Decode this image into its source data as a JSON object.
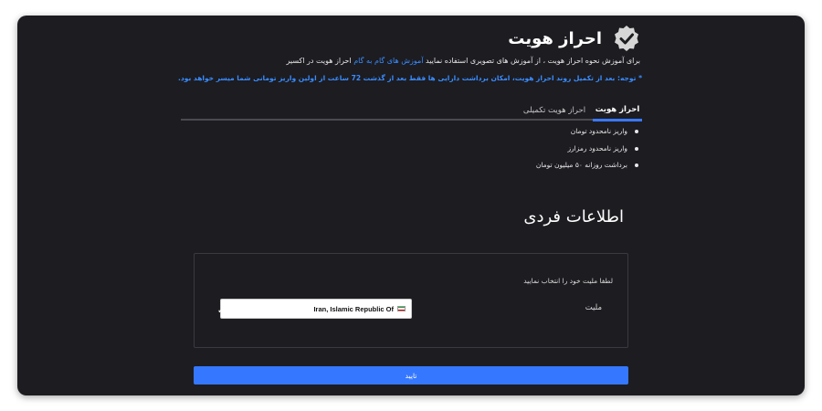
{
  "header": {
    "title": "احراز هویت",
    "intro_before": "برای آموزش نحوه احراز هویت ، از آموزش های تصویری استفاده نمایید",
    "intro_link": "آموزش های گام به گام",
    "intro_after": "احراز هویت در اکسیر",
    "notice": "* توجه: بعد از تکمیل روند احراز هویت، امکان برداشت دارایی ها فقط بعد از گذشت 72 ساعت از اولین واریز تومانی شما میسر خواهد بود."
  },
  "tabs": [
    {
      "label": "احراز هویت",
      "active": true
    },
    {
      "label": "احراز هویت تکمیلی",
      "active": false
    }
  ],
  "benefits": [
    "واریز نامحدود تومان",
    "واریز نامحدود رمزارز",
    "برداشت روزانه ۵۰ میلیون تومان"
  ],
  "section": {
    "title": "اطلاعات فردی"
  },
  "form": {
    "hint": "لطفا ملیت خود را انتخاب نمایید",
    "nationality_label": "ملیت",
    "nationality_value": "Iran, Islamic Republic Of",
    "submit_label": "تایید"
  },
  "colors": {
    "accent": "#3578ff",
    "link": "#3a8dff",
    "background": "#1c1c21"
  },
  "icons": {
    "badge": "verified-badge-icon",
    "flag": "iran-flag-icon",
    "check": "checkmark-icon"
  }
}
